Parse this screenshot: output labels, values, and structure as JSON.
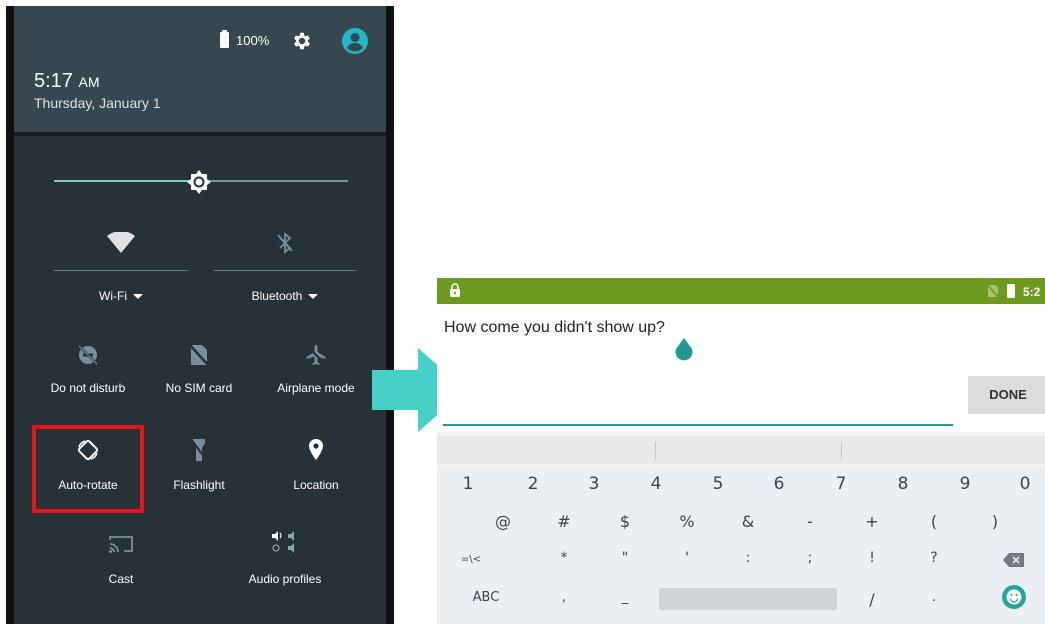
{
  "quick_settings": {
    "battery": "100%",
    "time": "5:17",
    "time_suffix": "AM",
    "date": "Thursday, January 1",
    "brightness_level": 0.49,
    "tiles": {
      "wifi": "Wi-Fi",
      "bluetooth": "Bluetooth",
      "do_not_disturb": "Do not disturb",
      "no_sim": "No SIM card",
      "airplane": "Airplane mode",
      "auto_rotate": "Auto-rotate",
      "flashlight": "Flashlight",
      "location": "Location",
      "cast": "Cast",
      "audio_profiles": "Audio profiles"
    },
    "highlighted_tile": "Auto-rotate"
  },
  "text_entry": {
    "status_time": "5:2",
    "input_text": "How come you didn't show up?",
    "done_label": "DONE",
    "keyboard": {
      "row1": [
        "1",
        "2",
        "3",
        "4",
        "5",
        "6",
        "7",
        "8",
        "9",
        "0"
      ],
      "row2": [
        "@",
        "#",
        "$",
        "%",
        "&",
        "-",
        "+",
        "(",
        ")"
      ],
      "row3": [
        "=\\<",
        "*",
        "\"",
        "'",
        ":",
        ";",
        "!",
        "?"
      ],
      "row4": [
        "ABC",
        ",",
        "_",
        "/",
        "."
      ]
    }
  },
  "colors": {
    "shade_header": "#37474f",
    "shade_body": "#263238",
    "accent_teal": "#80cbc4",
    "highlight_red": "#e8141c",
    "arrow_teal": "#45d0c8",
    "status_bar_green": "#6b9a1f",
    "cursor_teal": "#22998d"
  },
  "icons": [
    "battery-icon",
    "settings-icon",
    "account-icon",
    "brightness-icon",
    "wifi-icon",
    "bluetooth-icon",
    "do-not-disturb-icon",
    "no-sim-icon",
    "airplane-icon",
    "auto-rotate-icon",
    "flashlight-icon",
    "location-icon",
    "cast-icon",
    "audio-profiles-icon",
    "lock-icon",
    "backspace-icon",
    "emoji-icon",
    "arrow-icon"
  ]
}
